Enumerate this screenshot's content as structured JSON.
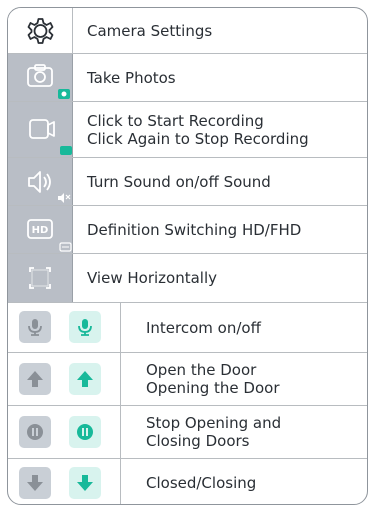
{
  "colors": {
    "border": "#8f959c",
    "icon_bg": "#b9bec6",
    "text": "#2a2f35",
    "green": "#18b99a",
    "green_bg": "#d8f3ee",
    "grey_btn": "#c9cfd6",
    "grey_icon": "#8a9097"
  },
  "settings_rows": [
    {
      "icon": "gear-icon",
      "label": "Camera Settings"
    },
    {
      "icon": "camera-icon",
      "label": "Take Photos"
    },
    {
      "icon": "video-camera-icon",
      "label_lines": [
        "Click to Start Recording",
        "Click Again to Stop Recording"
      ]
    },
    {
      "icon": "speaker-icon",
      "label": "Turn Sound on/off Sound"
    },
    {
      "icon": "hd-icon",
      "label": "Definition Switching HD/FHD"
    },
    {
      "icon": "fullscreen-icon",
      "label": "View Horizontally"
    }
  ],
  "button_rows": [
    {
      "icon": "microphone-icon",
      "label": "Intercom on/off"
    },
    {
      "icon": "arrow-up-icon",
      "label_lines": [
        "Open the Door",
        "Opening the Door"
      ]
    },
    {
      "icon": "pause-icon",
      "label_lines": [
        "Stop Opening and",
        "Closing Doors"
      ]
    },
    {
      "icon": "arrow-down-icon",
      "label": "Closed/Closing"
    }
  ],
  "badges": {
    "hd": "HD"
  }
}
